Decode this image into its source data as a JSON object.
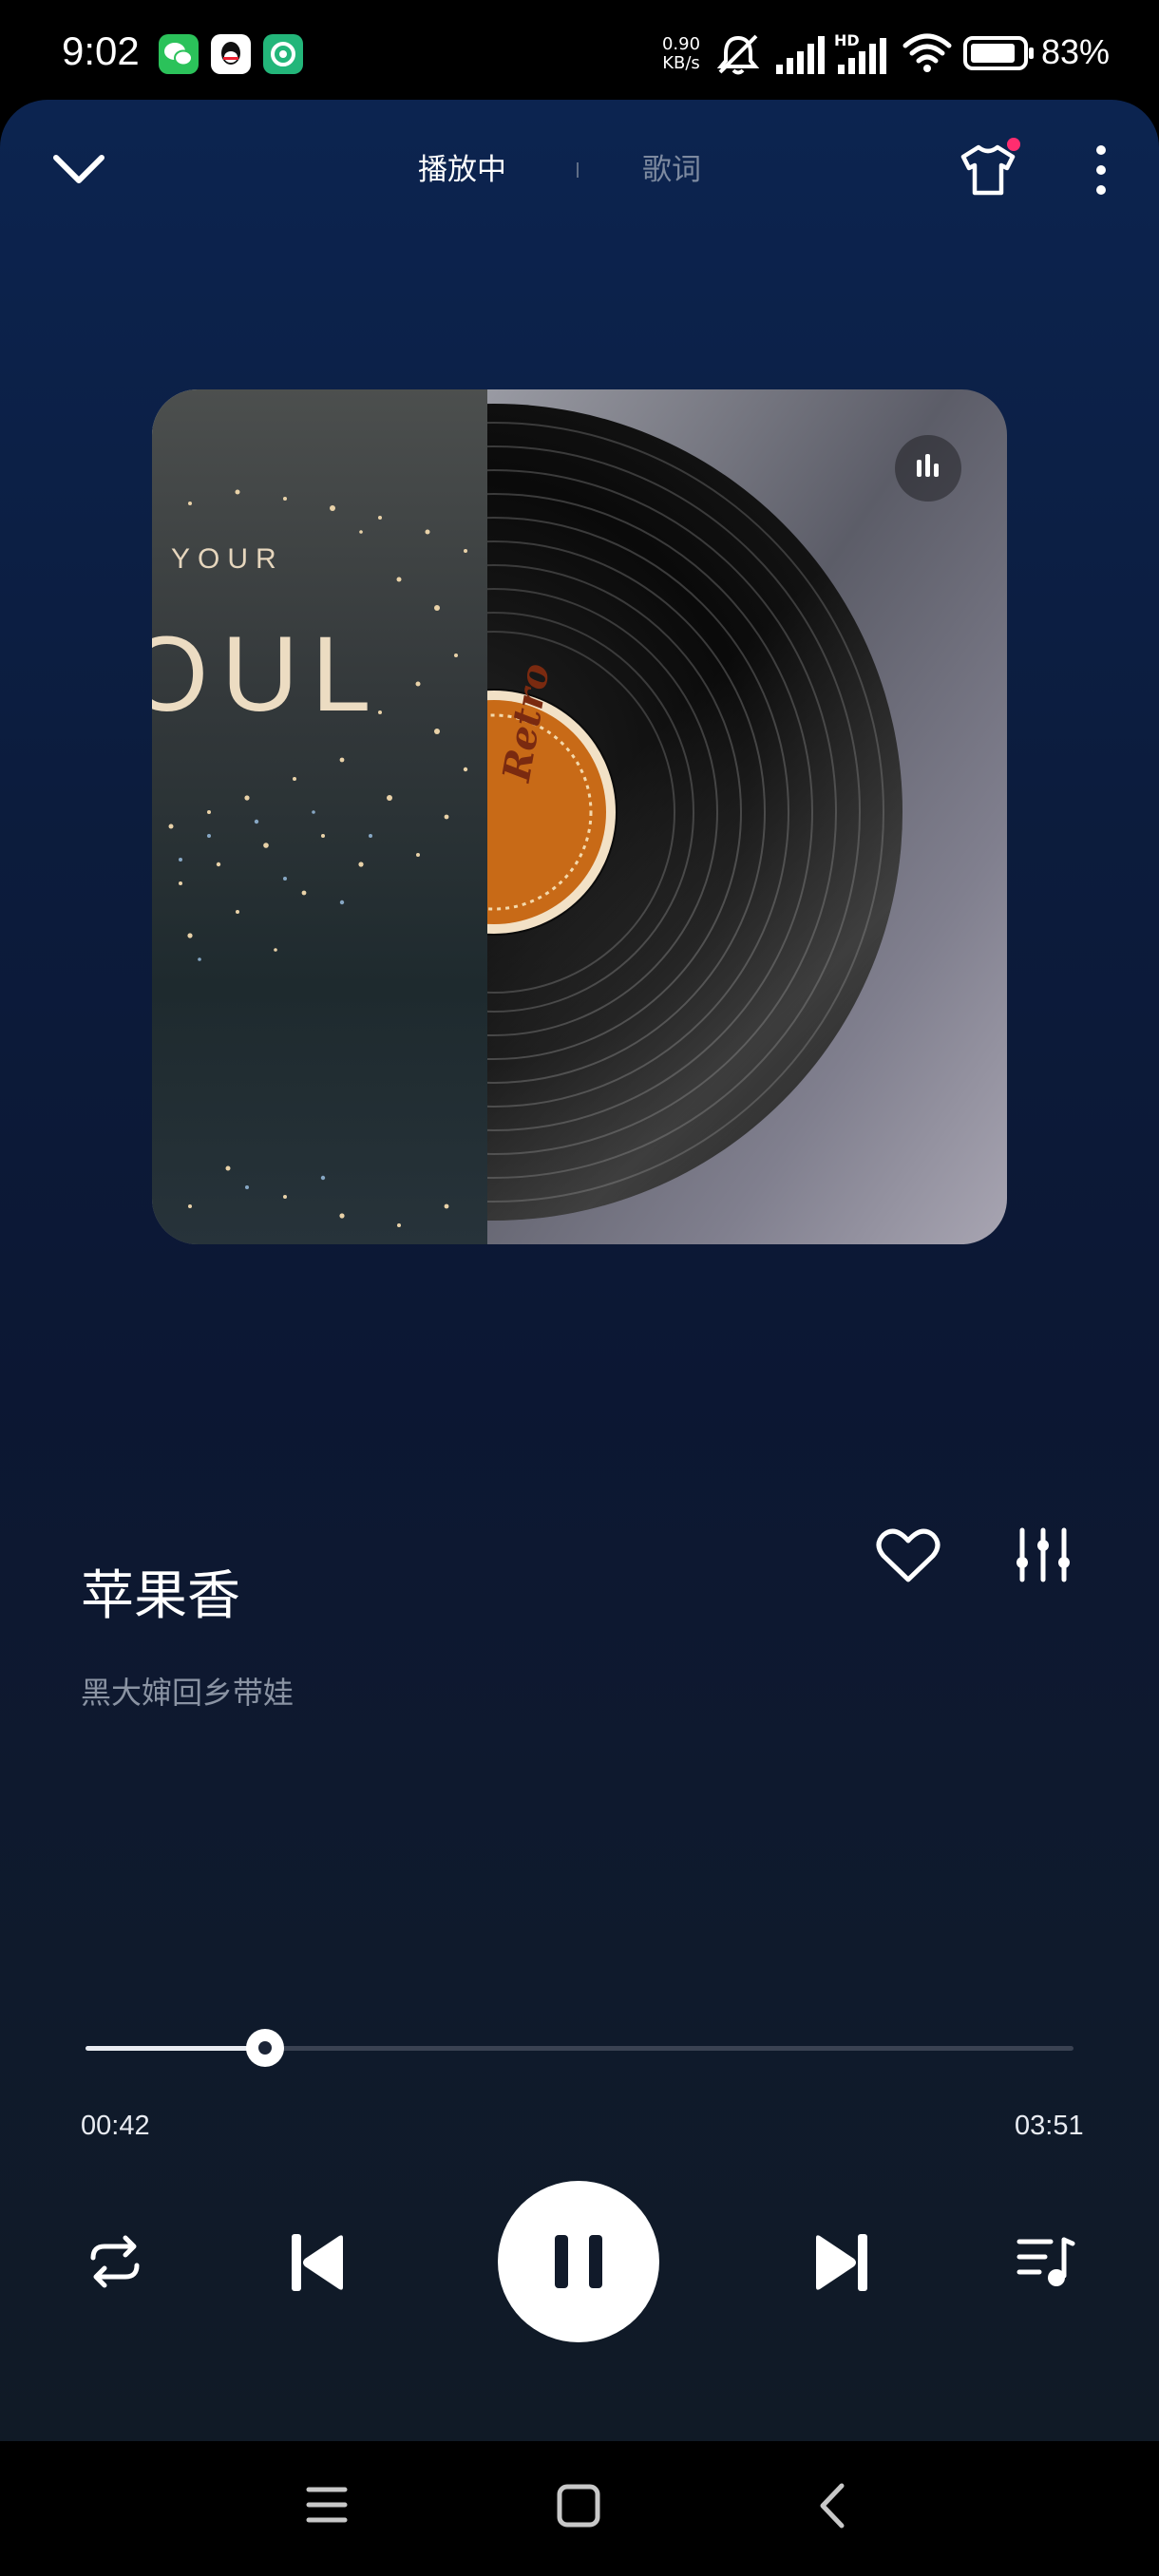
{
  "status_bar": {
    "time": "9:02",
    "net_speed_value": "0.90",
    "net_speed_unit": "KB/s",
    "battery": "83%",
    "signal_tag": "HD",
    "notification_icons": [
      "wechat-icon",
      "qq-icon",
      "app-icon"
    ]
  },
  "top_bar": {
    "tabs": [
      {
        "label": "播放中",
        "active": true
      },
      {
        "label": "歌词",
        "active": false
      }
    ],
    "skin_has_badge": true
  },
  "cover": {
    "text_line1": "YOUR",
    "text_line2": "OUL",
    "record_label": "Retro"
  },
  "song": {
    "title": "苹果香",
    "artist": "黑大婶回乡带娃",
    "liked": false
  },
  "progress": {
    "current": "00:42",
    "total": "03:51",
    "fraction": 0.182
  },
  "controls": {
    "mode": "repeat-all",
    "state": "playing"
  },
  "colors": {
    "bg_top": "#0c2450",
    "bg_bottom": "#101a26",
    "badge": "#ff2d6f",
    "secondary_text": "#8a93a3"
  }
}
